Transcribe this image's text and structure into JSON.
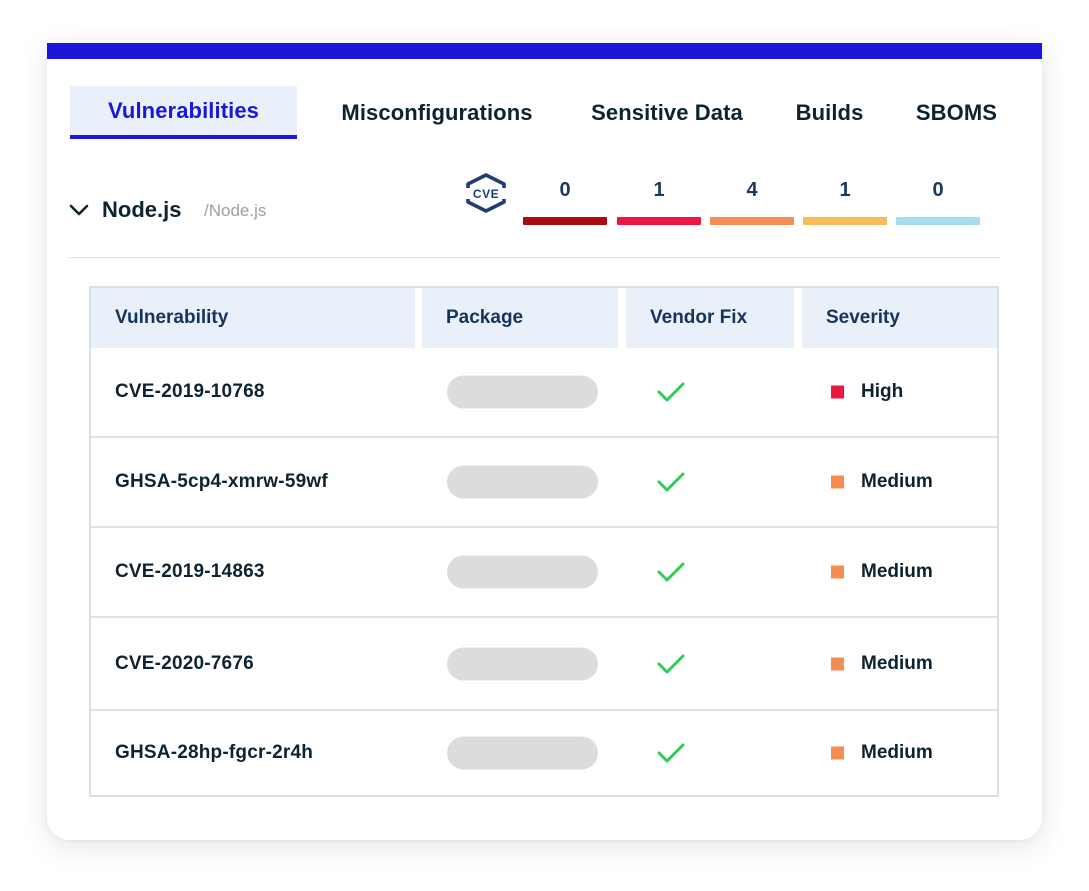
{
  "tabs": [
    {
      "label": "Vulnerabilities",
      "active": true
    },
    {
      "label": "Misconfigurations",
      "active": false
    },
    {
      "label": "Sensitive Data",
      "active": false
    },
    {
      "label": "Builds",
      "active": false
    },
    {
      "label": "SBOMS",
      "active": false
    }
  ],
  "project": {
    "name": "Node.js",
    "path": "/Node.js"
  },
  "summary": {
    "icon": "cve-shield-icon",
    "counts": [
      {
        "count": "0",
        "color": "#a80d12"
      },
      {
        "count": "1",
        "color": "#ee1643"
      },
      {
        "count": "4",
        "color": "#f48d54"
      },
      {
        "count": "1",
        "color": "#f6bc55"
      },
      {
        "count": "0",
        "color": "#a6dde8"
      }
    ]
  },
  "table": {
    "columns": [
      "Vulnerability",
      "Package",
      "Vendor Fix",
      "Severity"
    ],
    "rows": [
      {
        "vulnerability": "CVE-2019-10768",
        "vendor_fix": true,
        "severity": "High",
        "severity_color": "#ee1643"
      },
      {
        "vulnerability": "GHSA-5cp4-xmrw-59wf",
        "vendor_fix": true,
        "severity": "Medium",
        "severity_color": "#f48d54"
      },
      {
        "vulnerability": "CVE-2019-14863",
        "vendor_fix": true,
        "severity": "Medium",
        "severity_color": "#f48d54"
      },
      {
        "vulnerability": "CVE-2020-7676",
        "vendor_fix": true,
        "severity": "Medium",
        "severity_color": "#f48d54"
      },
      {
        "vulnerability": "GHSA-28hp-fgcr-2r4h",
        "vendor_fix": true,
        "severity": "Medium",
        "severity_color": "#f48d54"
      }
    ]
  },
  "colors": {
    "accent": "#1c16d8",
    "header_bg": "#eaf0fa",
    "check": "#2ecc55"
  }
}
